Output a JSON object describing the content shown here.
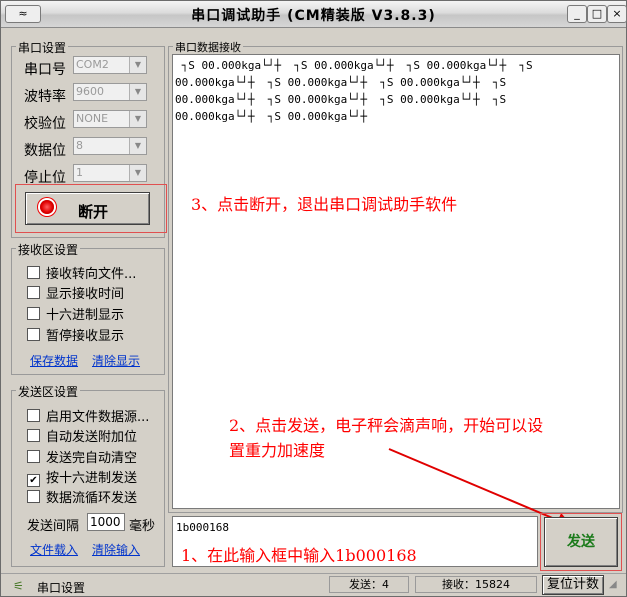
{
  "window": {
    "title": "串口调试助手 (CM精装版 V3.8.3)",
    "sysmenu": "≈"
  },
  "serial": {
    "group_title": "串口设置",
    "fields": [
      {
        "label": "串口号",
        "value": "COM2"
      },
      {
        "label": "波特率",
        "value": "9600"
      },
      {
        "label": "校验位",
        "value": "NONE"
      },
      {
        "label": "数据位",
        "value": "8"
      },
      {
        "label": "停止位",
        "value": "1"
      }
    ],
    "disconnect_label": "断开"
  },
  "receive": {
    "group_title": "接收区设置",
    "options": [
      {
        "label": "接收转向文件...",
        "checked": false
      },
      {
        "label": "显示接收时间",
        "checked": false
      },
      {
        "label": "十六进制显示",
        "checked": false
      },
      {
        "label": "暂停接收显示",
        "checked": false
      }
    ],
    "save_link": "保存数据",
    "clear_link": "清除显示"
  },
  "send_settings": {
    "group_title": "发送区设置",
    "options": [
      {
        "label": "启用文件数据源...",
        "checked": false
      },
      {
        "label": "自动发送附加位",
        "checked": false
      },
      {
        "label": "发送完自动清空",
        "checked": false
      },
      {
        "label": "按十六进制发送",
        "checked": true
      },
      {
        "label": "数据流循环发送",
        "checked": false
      }
    ],
    "interval_label": "发送间隔",
    "interval_value": "1000",
    "interval_unit": "毫秒",
    "file_link": "文件载入",
    "clear_link": "清除输入"
  },
  "receive_area": {
    "title": "串口数据接收",
    "lines": [
      " ┐S 00.000kga└┘┼  ┐S 00.000kga└┘┼  ┐S 00.000kga└┘┼  ┐S",
      "00.000kga└┘┼  ┐S 00.000kga└┘┼  ┐S 00.000kga└┘┼  ┐S",
      "00.000kga└┘┼  ┐S 00.000kga└┘┼  ┐S 00.000kga└┘┼  ┐S",
      "00.000kga└┘┼  ┐S 00.000kga└┘┼"
    ]
  },
  "send_area": {
    "value": "1b000168",
    "send_label": "发送"
  },
  "annotations": {
    "step3": "3、点击断开，退出串口调试助手软件",
    "step2_line1": "2、点击发送，电子秤会滴声响，开始可以设",
    "step2_line2": "置重力加速度",
    "step1": "1、在此输入框中输入1b000168"
  },
  "status": {
    "port_label": "串口设置",
    "sent": "发送：4",
    "received": "接收：15824",
    "reset_label": "复位计数"
  },
  "colors": {
    "annotation": "#ff0000",
    "link": "#0033cc",
    "send_btn_text": "#1a7a1a",
    "window_bg": "#d4d0c8"
  }
}
